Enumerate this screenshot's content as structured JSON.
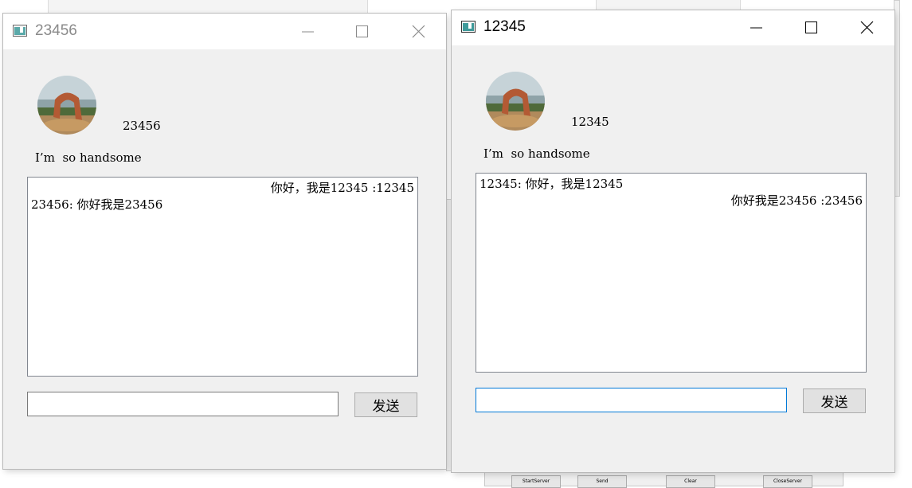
{
  "background": {
    "buttons": [
      "StartServer",
      "Send",
      "Clear",
      "CloseServer"
    ]
  },
  "windows": [
    {
      "title": "23456",
      "active": false,
      "username": "23456",
      "signature": "I’m  so handsome",
      "messages": [
        {
          "text": "你好，我是12345 :12345",
          "align": "right"
        },
        {
          "text": "23456: 你好我是23456",
          "align": "left"
        }
      ],
      "input_value": "",
      "send_label": "发送"
    },
    {
      "title": "12345",
      "active": true,
      "username": "12345",
      "signature": "I’m  so handsome",
      "messages": [
        {
          "text": "12345: 你好，我是12345",
          "align": "left"
        },
        {
          "text": "你好我是23456 :23456",
          "align": "right"
        }
      ],
      "input_value": "",
      "send_label": "发送"
    }
  ],
  "colors": {
    "inactive_title": "#8a8a8a",
    "active_title": "#000000",
    "focus_border": "#0078d7"
  }
}
